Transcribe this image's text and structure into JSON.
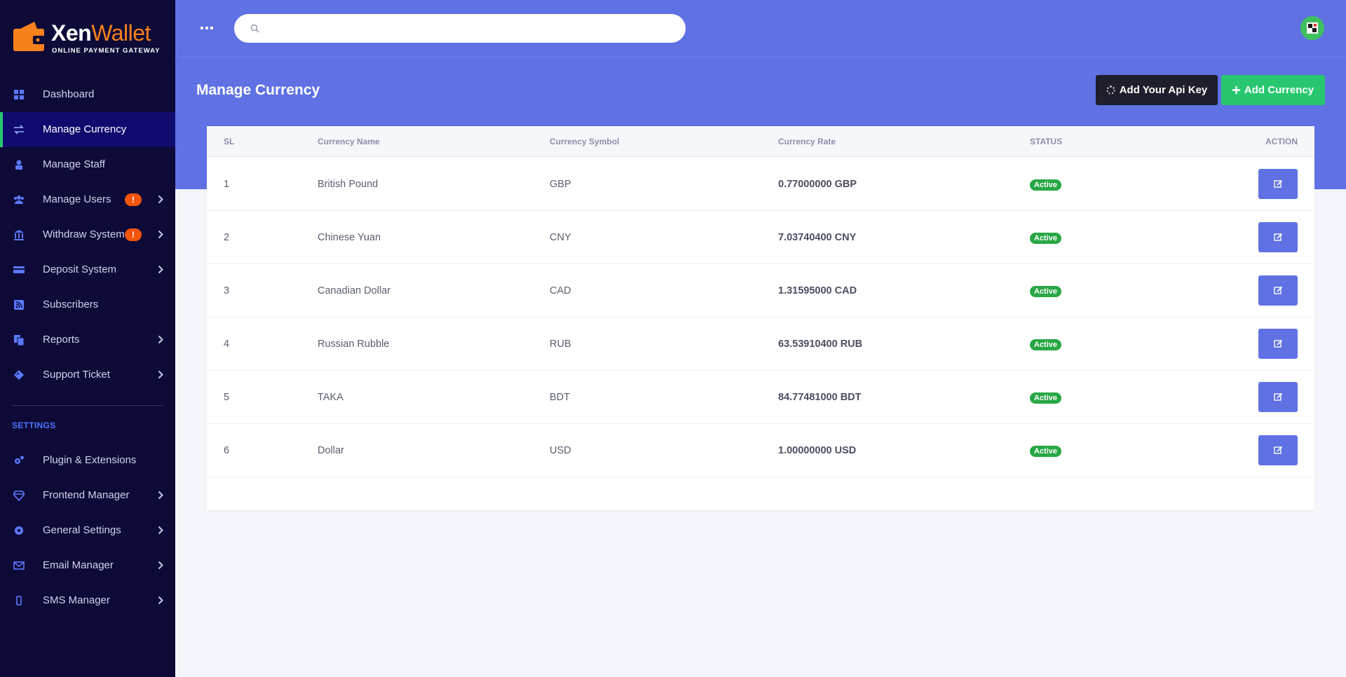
{
  "logo": {
    "brand_main": "Xen",
    "brand_accent": "Wallet",
    "tagline": "ONLINE PAYMENT GATEWAY"
  },
  "sidebar": {
    "items": [
      {
        "label": "Dashboard",
        "icon": "dashboard-icon"
      },
      {
        "label": "Manage Currency",
        "icon": "exchange-icon",
        "active": true
      },
      {
        "label": "Manage Staff",
        "icon": "user-lock-icon"
      },
      {
        "label": "Manage Users",
        "icon": "users-icon",
        "badge": "!"
      },
      {
        "label": "Withdraw System",
        "icon": "bank-icon",
        "badge": "!"
      },
      {
        "label": "Deposit System",
        "icon": "credit-card-icon"
      },
      {
        "label": "Subscribers",
        "icon": "rss-icon"
      },
      {
        "label": "Reports",
        "icon": "copy-icon"
      },
      {
        "label": "Support Ticket",
        "icon": "ticket-icon"
      }
    ],
    "settings_heading": "SETTINGS",
    "settings_items": [
      {
        "label": "Plugin & Extensions",
        "icon": "cogs-icon"
      },
      {
        "label": "Frontend Manager",
        "icon": "diamond-icon"
      },
      {
        "label": "General Settings",
        "icon": "cog-icon"
      },
      {
        "label": "Email Manager",
        "icon": "envelope-icon"
      },
      {
        "label": "SMS Manager",
        "icon": "mobile-icon"
      }
    ]
  },
  "header": {
    "search_placeholder": "",
    "search_value": ""
  },
  "page": {
    "title": "Manage Currency",
    "api_button": "Add Your Api Key",
    "add_button": "Add Currency"
  },
  "table": {
    "columns": [
      "SL",
      "Currency Name",
      "Currency Symbol",
      "Currency Rate",
      "STATUS",
      "ACTION"
    ],
    "rows": [
      {
        "sl": "1",
        "name": "British Pound",
        "symbol": "GBP",
        "rate": "0.77000000 GBP",
        "status": "Active"
      },
      {
        "sl": "2",
        "name": "Chinese Yuan",
        "symbol": "CNY",
        "rate": "7.03740400 CNY",
        "status": "Active"
      },
      {
        "sl": "3",
        "name": "Canadian Dollar",
        "symbol": "CAD",
        "rate": "1.31595000 CAD",
        "status": "Active"
      },
      {
        "sl": "4",
        "name": "Russian Rubble",
        "symbol": "RUB",
        "rate": "63.53910400 RUB",
        "status": "Active"
      },
      {
        "sl": "5",
        "name": "TAKA",
        "symbol": "BDT",
        "rate": "84.77481000 BDT",
        "status": "Active"
      },
      {
        "sl": "6",
        "name": "Dollar",
        "symbol": "USD",
        "rate": "1.00000000 USD",
        "status": "Active"
      }
    ]
  },
  "colors": {
    "primary": "#5f71e3",
    "sidebar": "#0d0a37",
    "success": "#28c76f",
    "badge": "#f3540c",
    "accent": "#f7821b"
  }
}
